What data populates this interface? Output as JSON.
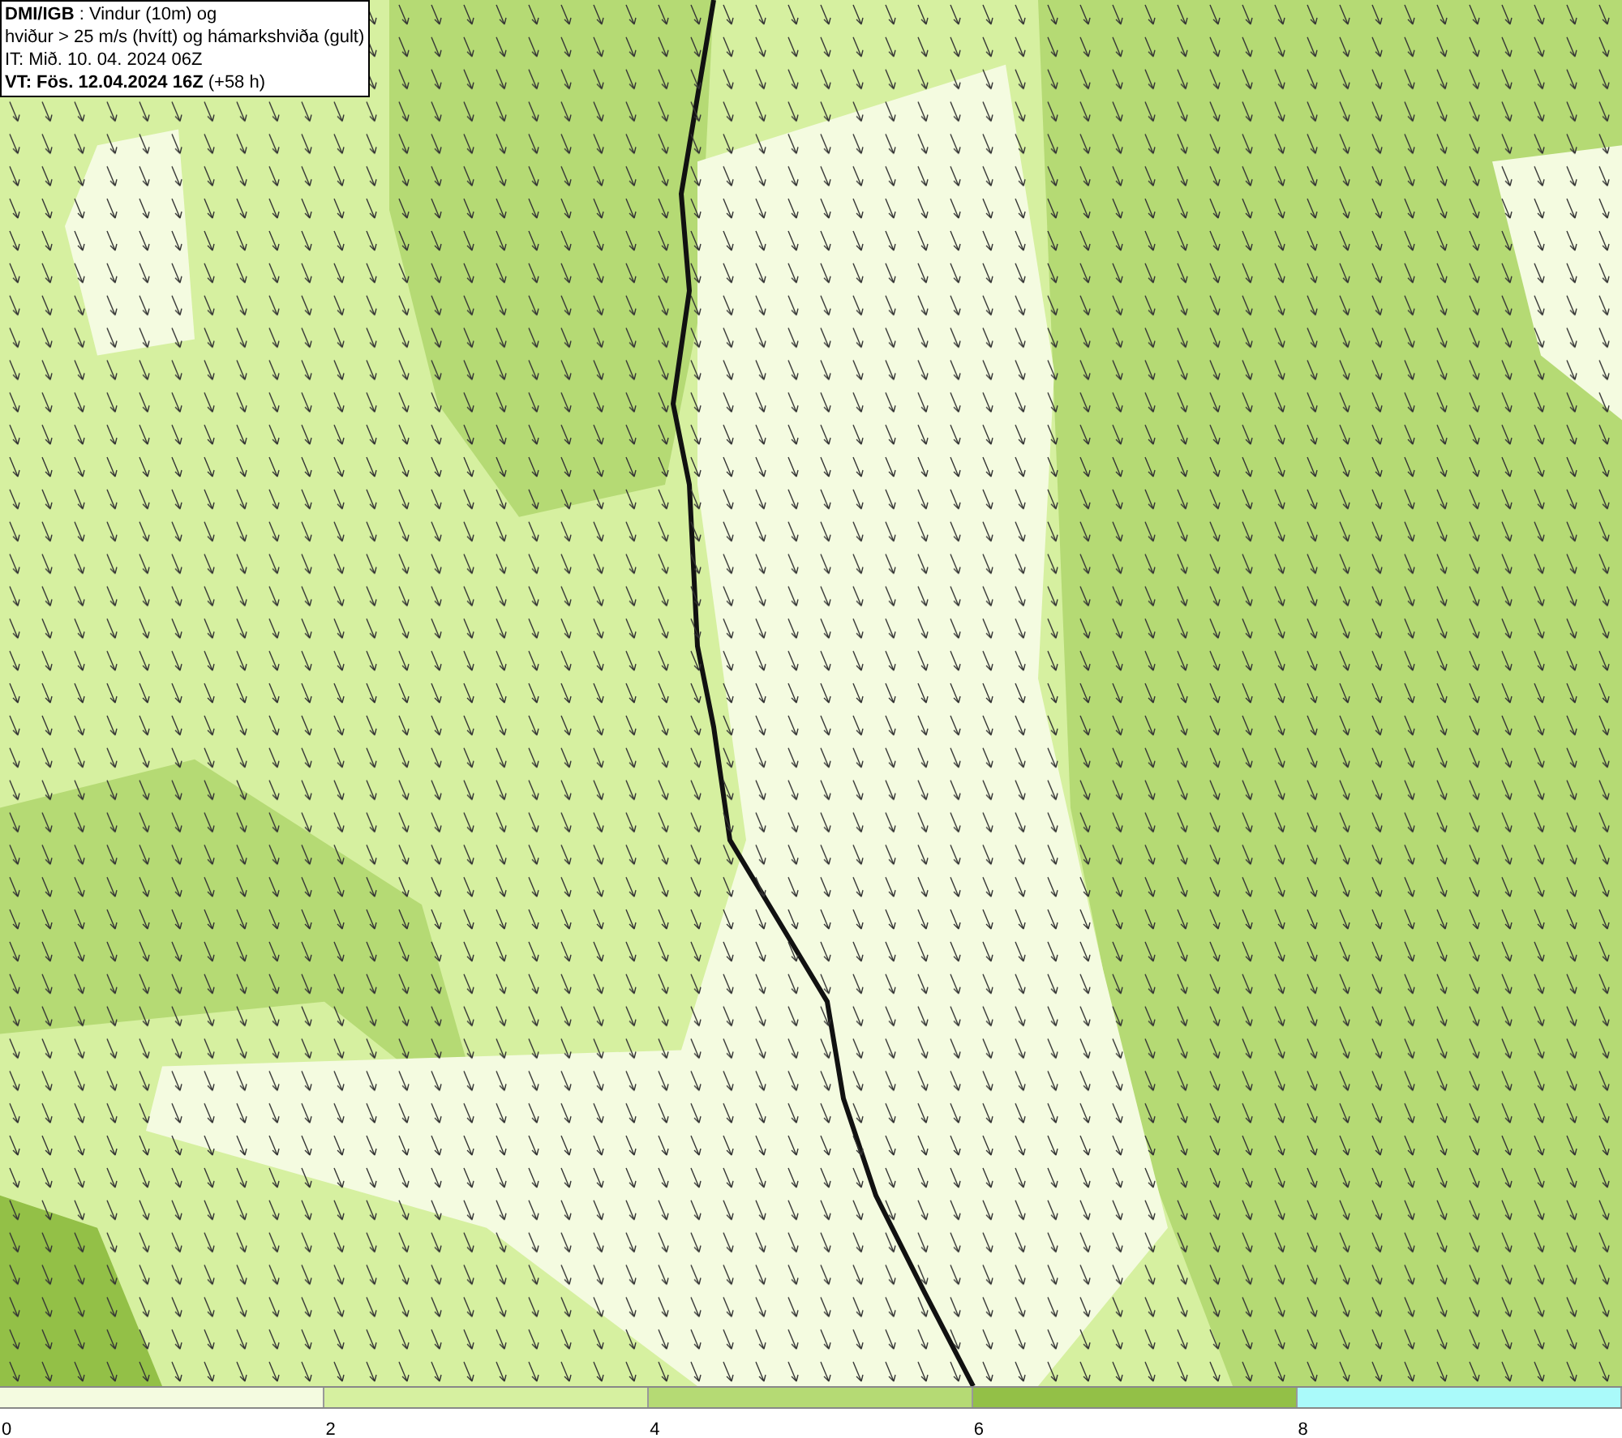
{
  "info_box": {
    "lines": [
      "**DMI/IGB** : Vindur (10m) og",
      "hviður > 25 m/s (hvítt) og hámarkshviða (gult)",
      "IT: Mið. 10. 04. 2024 06Z",
      "**VT: Fös. 12.04.2024 16Z** (+58 h)"
    ]
  },
  "legend": {
    "bins": [
      {
        "color": "#f4fbe0",
        "tick": "0"
      },
      {
        "color": "#d6f0a0",
        "tick": "2"
      },
      {
        "color": "#b5da74",
        "tick": "4"
      },
      {
        "color": "#93c047",
        "tick": "6"
      },
      {
        "color": "#aafafa",
        "tick": "8"
      }
    ]
  }
}
